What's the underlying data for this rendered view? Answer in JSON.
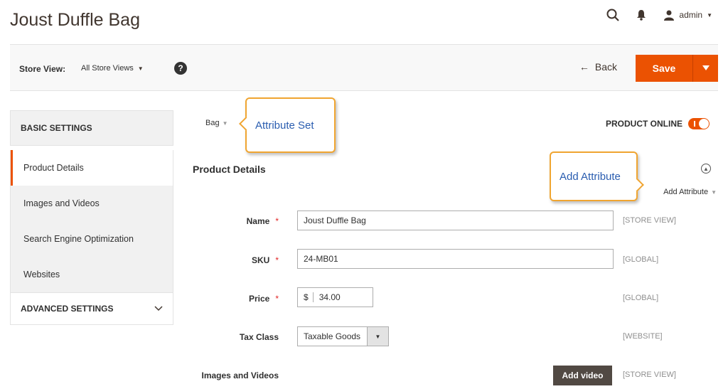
{
  "header": {
    "title": "Joust Duffle Bag",
    "user": "admin"
  },
  "store_bar": {
    "label": "Store View:",
    "value": "All Store Views",
    "help": "?",
    "back_label": "Back",
    "save_label": "Save"
  },
  "sidebar": {
    "basic_heading": "BASIC SETTINGS",
    "items": [
      {
        "label": "Product Details"
      },
      {
        "label": "Images and Videos"
      },
      {
        "label": "Search Engine Optimization"
      },
      {
        "label": "Websites"
      }
    ],
    "advanced_heading": "ADVANCED SETTINGS"
  },
  "main": {
    "attribute_set_value": "Bag",
    "callout_attribute_set": "Attribute Set",
    "callout_add_attribute": "Add Attribute",
    "product_online_label": "PRODUCT ONLINE",
    "section_title": "Product Details",
    "add_attribute_label": "Add Attribute",
    "fields": {
      "name": {
        "label": "Name",
        "value": "Joust Duffle Bag",
        "scope": "[STORE VIEW]"
      },
      "sku": {
        "label": "SKU",
        "value": "24-MB01",
        "scope": "[GLOBAL]"
      },
      "price": {
        "label": "Price",
        "currency": "$",
        "value": "34.00",
        "scope": "[GLOBAL]"
      },
      "tax_class": {
        "label": "Tax Class",
        "value": "Taxable Goods",
        "scope": "[WEBSITE]"
      },
      "images": {
        "label": "Images and Videos",
        "button": "Add video",
        "scope": "[STORE VIEW]"
      }
    },
    "required_mark": "*"
  },
  "colors": {
    "accent": "#eb5202",
    "callout_border": "#f0a531",
    "callout_text": "#2a5db0"
  }
}
